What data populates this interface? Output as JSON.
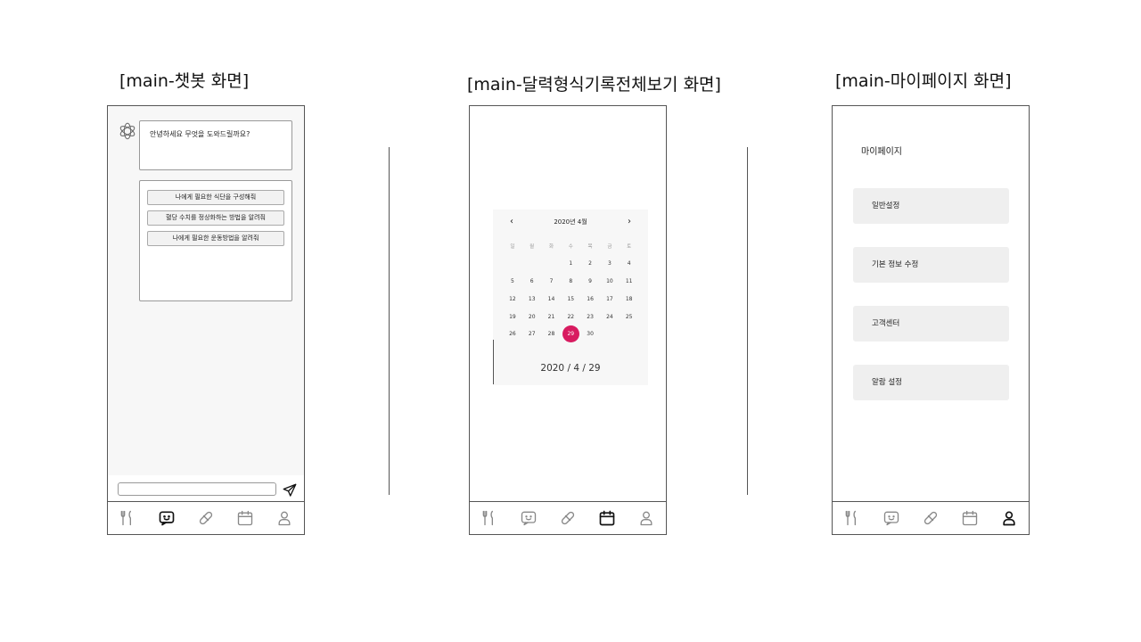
{
  "captions": {
    "chat": "[main-챗봇 화면]",
    "calendar": "[main-달력형식기록전체보기 화면]",
    "mypage": "[main-마이페이지 화면]"
  },
  "chatbot": {
    "greeting": "안녕하세요 무엇을 도와드릴까요?",
    "suggestions": [
      "나에게 필요한 식단을 구성해줘",
      "혈당 수치를 정상화하는 방법을 알려줘",
      "나에게 필요한 운동방법을 알려줘"
    ],
    "input_value": "",
    "input_placeholder": ""
  },
  "calendar": {
    "month_title": "2020년 4월",
    "weekdays": [
      "일",
      "월",
      "화",
      "수",
      "목",
      "금",
      "토"
    ],
    "first_weekday_index": 3,
    "days_in_month": 30,
    "selected_day": 29,
    "selected_color": "#d81b60",
    "selected_date_text": "2020 / 4 / 29"
  },
  "mypage": {
    "title": "마이페이지",
    "menu": [
      "일반설정",
      "기본 정보 수정",
      "고객센터",
      "알람 설정"
    ]
  },
  "nav": {
    "items": [
      "fork-knife-icon",
      "chat-bubble-icon",
      "pill-icon",
      "calendar-icon",
      "person-icon"
    ],
    "active": {
      "chat": 1,
      "calendar": 3,
      "mypage": 4
    }
  }
}
